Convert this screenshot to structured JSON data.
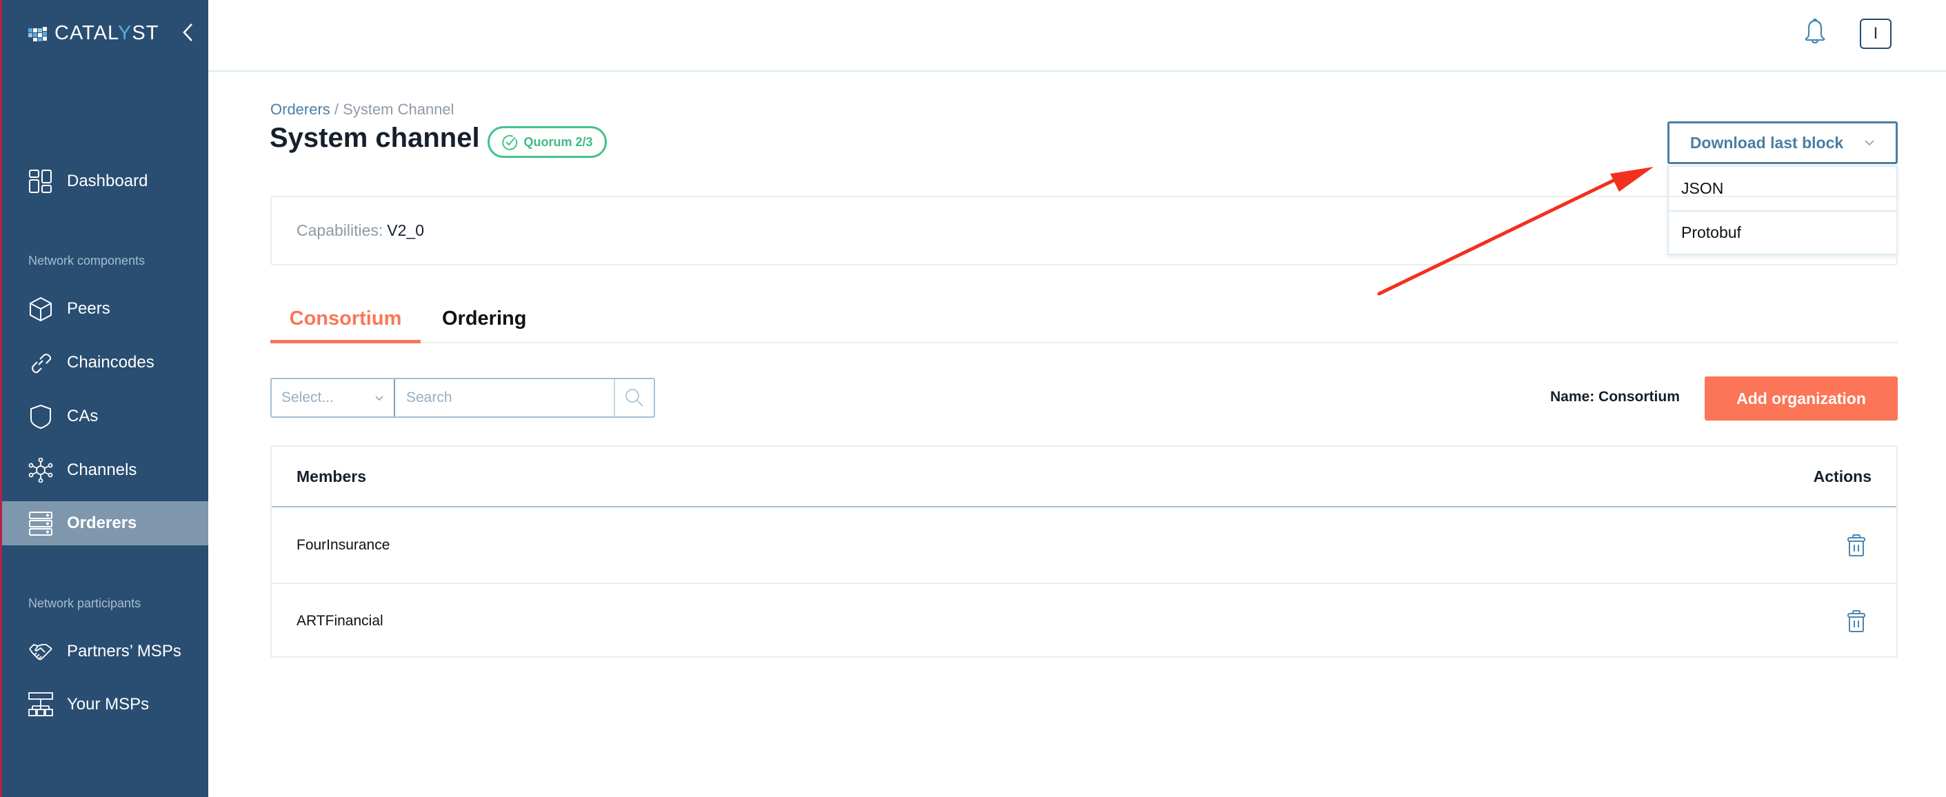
{
  "app": {
    "logo_text_pre": "CATAL",
    "logo_text_y": "Y",
    "logo_text_post": "ST"
  },
  "sidebar": {
    "items": [
      {
        "label": "Dashboard",
        "icon": "dashboard-icon"
      },
      {
        "label": "Peers",
        "icon": "cube-icon"
      },
      {
        "label": "Chaincodes",
        "icon": "link-icon"
      },
      {
        "label": "CAs",
        "icon": "shield-icon"
      },
      {
        "label": "Channels",
        "icon": "network-icon"
      },
      {
        "label": "Orderers",
        "icon": "server-icon",
        "active": true
      },
      {
        "label": "Partners’ MSPs",
        "icon": "handshake-icon"
      },
      {
        "label": "Your MSPs",
        "icon": "hierarchy-icon"
      }
    ],
    "sections": {
      "network_components": "Network components",
      "network_participants": "Network participants"
    }
  },
  "header": {
    "user_initial": "I"
  },
  "breadcrumb": {
    "parent": "Orderers",
    "separator": " / ",
    "current": "System Channel"
  },
  "page": {
    "title": "System channel",
    "quorum_badge": "Quorum 2/3"
  },
  "download": {
    "label": "Download last block",
    "options": [
      "JSON",
      "Protobuf"
    ]
  },
  "capabilities": {
    "label": "Capabilities:",
    "value": "V2_0"
  },
  "tabs": [
    {
      "label": "Consortium",
      "active": true
    },
    {
      "label": "Ordering",
      "active": false
    }
  ],
  "filter": {
    "select_placeholder": "Select...",
    "search_placeholder": "Search"
  },
  "consortium": {
    "name_label": "Name:",
    "name_value": "Consortium",
    "add_button": "Add organization"
  },
  "table": {
    "columns": [
      "Members",
      "Actions"
    ],
    "rows": [
      {
        "member": "FourInsurance"
      },
      {
        "member": "ARTFinancial"
      }
    ]
  },
  "colors": {
    "sidebar_bg": "#2a4e72",
    "accent_orange": "#fb7556",
    "quorum_green": "#45c28b",
    "primary_blue": "#4a7ea3",
    "annotation_red": "#f3301e"
  }
}
